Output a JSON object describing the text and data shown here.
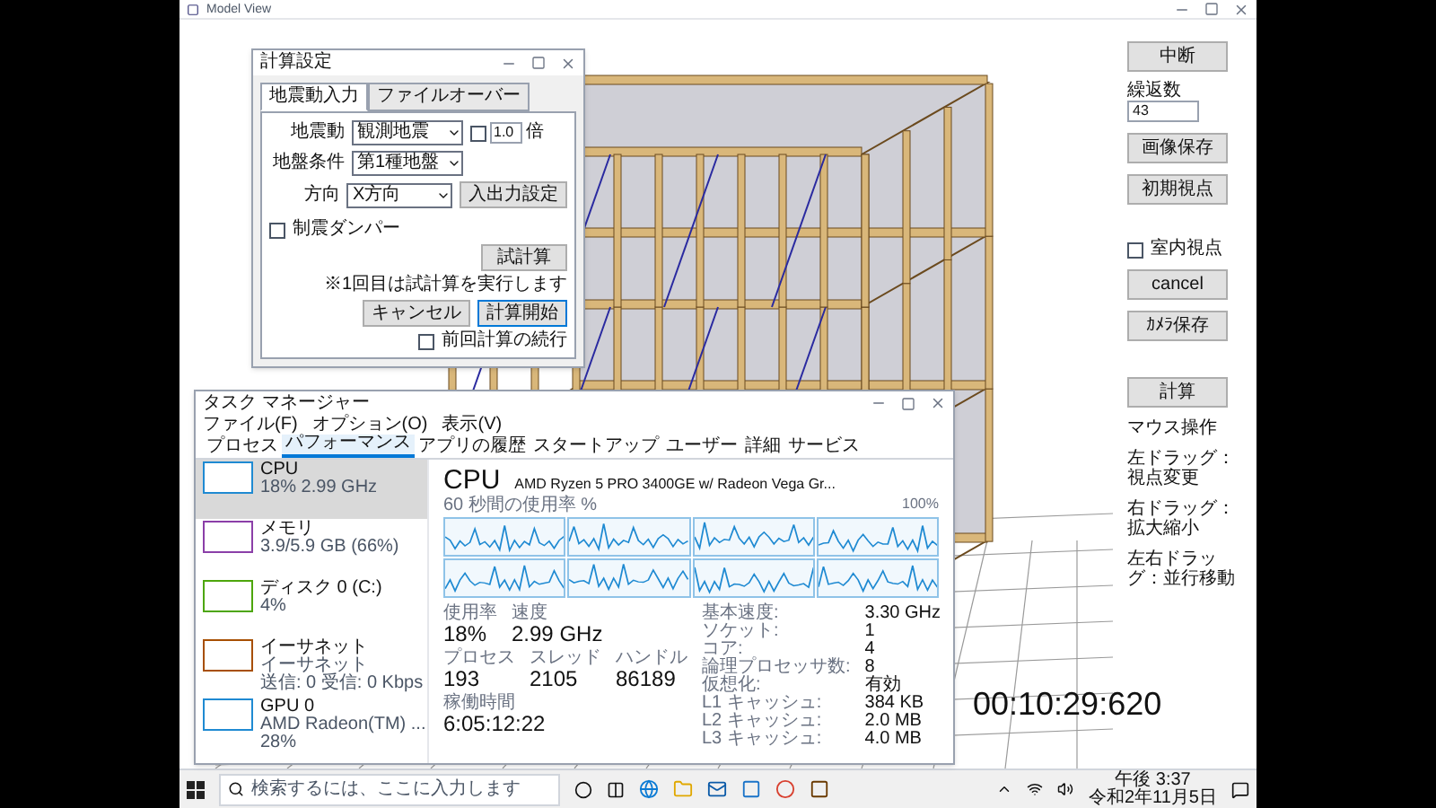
{
  "window": {
    "title": "Model View"
  },
  "side_panel": {
    "groups": [
      [
        {
          "kind": "button",
          "label": "中断"
        },
        {
          "kind": "field",
          "label": "繰返数",
          "value": "43"
        },
        {
          "kind": "button",
          "label": "画像保存"
        },
        {
          "kind": "button",
          "label": "初期視点"
        }
      ],
      [
        {
          "kind": "checkbox",
          "label": "室内視点",
          "checked": false
        },
        {
          "kind": "button",
          "label": "cancel"
        },
        {
          "kind": "button",
          "label": "ｶﾒﾗ保存"
        }
      ],
      [
        {
          "kind": "button",
          "label": "計算"
        },
        {
          "kind": "text",
          "label": "マウス操作"
        },
        {
          "kind": "text",
          "label": "左ドラッグ：視点変更"
        },
        {
          "kind": "text",
          "label": "右ドラッグ：拡大縮小"
        },
        {
          "kind": "text",
          "label": "左右ドラッグ：並行移動"
        }
      ]
    ]
  },
  "dialog": {
    "title": "計算設定",
    "tabs": [
      {
        "label": "地震動入力",
        "selected": true
      },
      {
        "label": "ファイルオーバー",
        "selected": false
      }
    ],
    "fields": [
      {
        "label": "地震動",
        "value": "観測地震"
      },
      {
        "label": "地盤条件",
        "value": "第1種地盤"
      },
      {
        "label": "方向",
        "value": "X方向"
      }
    ],
    "scale": {
      "checked": false,
      "value": "1.0",
      "unit": "倍"
    },
    "io_button": "入出力設定",
    "damper": {
      "label": "制震ダンパー",
      "checked": false
    },
    "trial_button": "試計算",
    "note": "※1回目は試計算を実行します",
    "cancel_button": "キャンセル",
    "start_button": "計算開始",
    "resume": {
      "label": "前回計算の続行",
      "checked": false
    }
  },
  "task_manager": {
    "title": "タスク マネージャー",
    "menu": [
      "ファイル(F)",
      "オプション(O)",
      "表示(V)"
    ],
    "tabs": [
      {
        "label": "プロセス",
        "selected": false
      },
      {
        "label": "パフォーマンス",
        "selected": true
      },
      {
        "label": "アプリの履歴",
        "selected": false
      },
      {
        "label": "スタートアップ",
        "selected": false
      },
      {
        "label": "ユーザー",
        "selected": false
      },
      {
        "label": "詳細",
        "selected": false
      },
      {
        "label": "サービス",
        "selected": false
      }
    ],
    "resources": [
      {
        "name": "CPU",
        "lines": [
          "18% 2.99 GHz"
        ],
        "selected": true,
        "color": "#1f8ad2"
      },
      {
        "name": "メモリ",
        "lines": [
          "3.9/5.9 GB (66%)"
        ],
        "selected": false,
        "color": "#8b3fa8"
      },
      {
        "name": "ディスク 0 (C:)",
        "lines": [
          "4%"
        ],
        "selected": false,
        "color": "#4da60c"
      },
      {
        "name": "イーサネット",
        "lines": [
          "イーサネット",
          "送信: 0 受信: 0 Kbps"
        ],
        "selected": false,
        "color": "#a74f01"
      },
      {
        "name": "GPU 0",
        "lines": [
          "AMD Radeon(TM) ...",
          "28%"
        ],
        "selected": false,
        "color": "#1f8ad2"
      }
    ],
    "cpu": {
      "title": "CPU",
      "model": "AMD Ryzen 5 PRO 3400GE w/ Radeon Vega Gr...",
      "graph_label": "60 秒間の使用率 %",
      "graph_max": "100%",
      "stats": [
        [
          {
            "label": "使用率",
            "value": "18%"
          },
          {
            "label": "速度",
            "value": "2.99 GHz"
          }
        ],
        [
          {
            "label": "プロセス",
            "value": "193"
          },
          {
            "label": "スレッド",
            "value": "2105"
          },
          {
            "label": "ハンドル",
            "value": "86189"
          }
        ],
        [
          {
            "label": "稼働時間",
            "value": "6:05:12:22"
          }
        ]
      ],
      "specs": [
        {
          "label": "基本速度:",
          "value": "3.30 GHz"
        },
        {
          "label": "ソケット:",
          "value": "1"
        },
        {
          "label": "コア:",
          "value": "4"
        },
        {
          "label": "論理プロセッサ数:",
          "value": "8"
        },
        {
          "label": "仮想化:",
          "value": "有効"
        },
        {
          "label": "L1 キャッシュ:",
          "value": "384 KB"
        },
        {
          "label": "L2 キャッシュ:",
          "value": "2.0 MB"
        },
        {
          "label": "L3 キャッシュ:",
          "value": "4.0 MB"
        }
      ]
    }
  },
  "recorder_timer": "00:10:29:620",
  "taskbar": {
    "search_placeholder": "検索するには、ここに入力します",
    "time": "午後 3:37",
    "date": "令和2年11月5日"
  }
}
